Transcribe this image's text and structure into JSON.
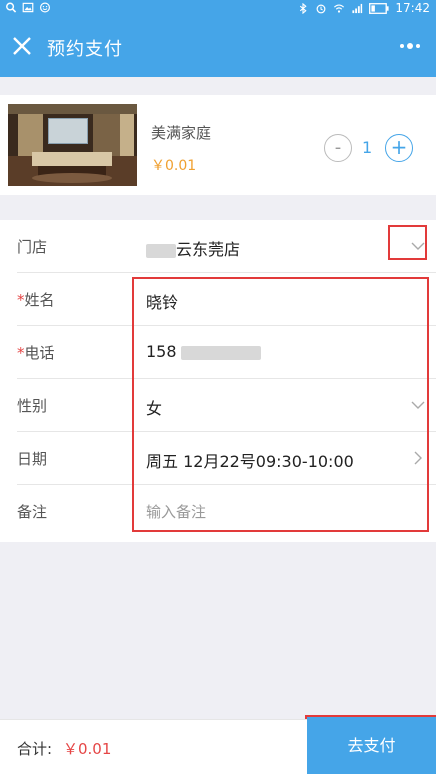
{
  "status_bar": {
    "time": "17:42"
  },
  "nav": {
    "title": "预约支付"
  },
  "product": {
    "name": "美满家庭",
    "price": "￥0.01",
    "quantity": "1",
    "minus_label": "-",
    "plus_label": "+"
  },
  "form": {
    "store": {
      "label": "门店",
      "value": "云东莞店"
    },
    "name": {
      "required_mark": "*",
      "label": "姓名",
      "value": "晓铃"
    },
    "phone": {
      "required_mark": "*",
      "label": "电话",
      "value": "158"
    },
    "gender": {
      "label": "性别",
      "value": "女"
    },
    "date": {
      "label": "日期",
      "value": "周五 12月22号09:30-10:00"
    },
    "remark": {
      "label": "备注",
      "placeholder": "输入备注"
    }
  },
  "footer": {
    "total_label": "合计:",
    "total_value": "￥0.01",
    "pay_button": "去支付"
  },
  "colors": {
    "primary": "#45a5e8",
    "price": "#f0a030",
    "accent_red": "#e54646"
  }
}
